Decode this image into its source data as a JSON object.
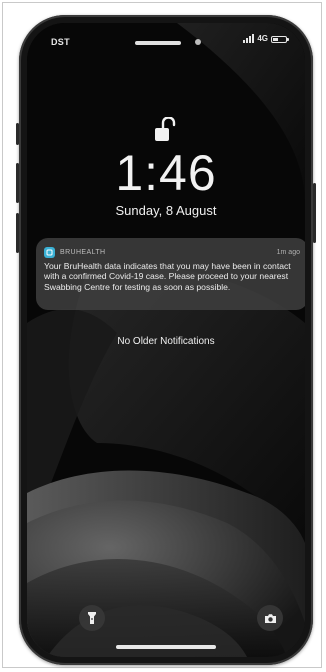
{
  "status_bar": {
    "carrier": "DST",
    "network": "4G",
    "battery_level": 0.45
  },
  "lock_screen": {
    "time": "1:46",
    "date": "Sunday, 8 August",
    "no_older_label": "No Older Notifications"
  },
  "notification": {
    "app_name": "BRUHEALTH",
    "time_ago": "1m ago",
    "body": "Your BruHealth data indicates that you may have been in contact with a confirmed Covid-19 case. Please proceed to your nearest Swabbing Centre for testing as soon as possible."
  },
  "icons": {
    "lock": "unlocked-padlock-icon",
    "flashlight": "flashlight-icon",
    "camera": "camera-icon",
    "app": "bruhealth-app-icon"
  },
  "colors": {
    "notification_bg": "#3e3e3e",
    "app_icon_accent": "#3ab0d4",
    "screen_bg": "#050505"
  }
}
